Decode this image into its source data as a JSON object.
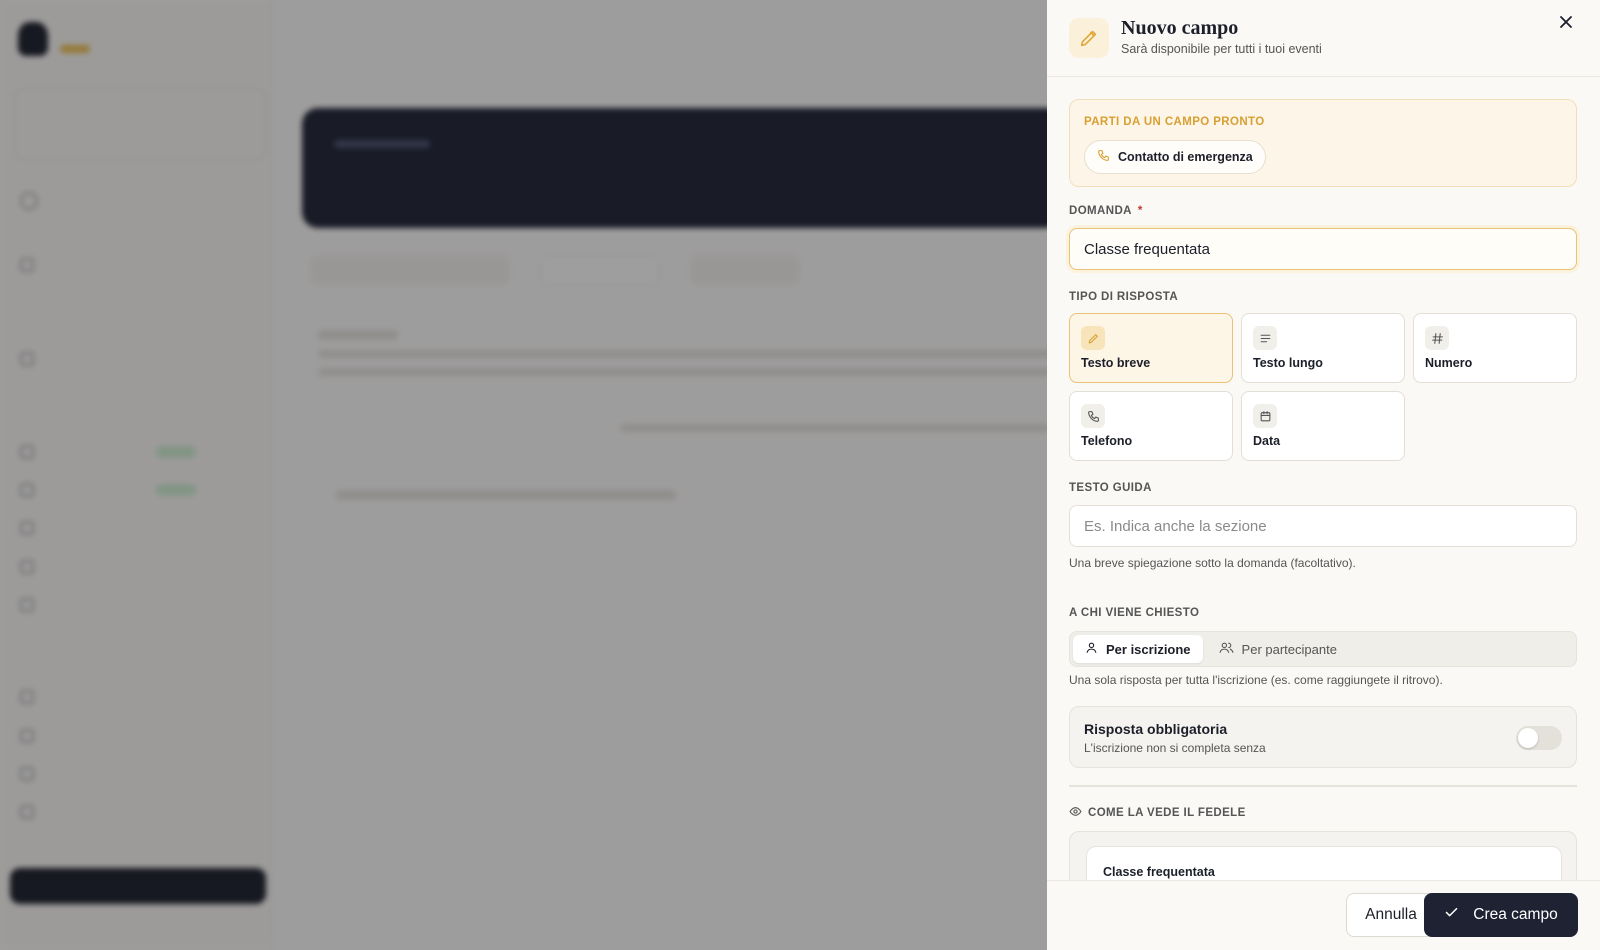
{
  "drawer": {
    "title": "Nuovo campo",
    "subtitle": "Sarà disponibile per tutti i tuoi eventi",
    "preset": {
      "label": "PARTI DA UN CAMPO PRONTO",
      "chip_label": "Contatto di emergenza"
    },
    "question": {
      "label": "DOMANDA",
      "required_mark": "*",
      "value": "Classe frequentata"
    },
    "answer_type": {
      "label": "TIPO DI RISPOSTA",
      "selected": "Testo breve",
      "options": [
        {
          "label": "Testo breve",
          "icon": "pencil-icon"
        },
        {
          "label": "Testo lungo",
          "icon": "lines-icon"
        },
        {
          "label": "Numero",
          "icon": "hash-icon"
        },
        {
          "label": "Telefono",
          "icon": "phone-icon"
        },
        {
          "label": "Data",
          "icon": "calendar-icon"
        }
      ]
    },
    "guide_text": {
      "label": "TESTO GUIDA",
      "placeholder": "Es. Indica anche la sezione",
      "help": "Una breve spiegazione sotto la domanda (facoltativo)."
    },
    "asked_to": {
      "label": "A CHI VIENE CHIESTO",
      "options": [
        "Per iscrizione",
        "Per partecipante"
      ],
      "selected": "Per iscrizione",
      "help": "Una sola risposta per tutta l'iscrizione (es. come raggiungete il ritrovo)."
    },
    "required": {
      "title": "Risposta obbligatoria",
      "subtitle": "L'iscrizione non si completa senza",
      "on": false
    },
    "preview": {
      "label": "COME LA VEDE IL FEDELE",
      "question": "Classe frequentata"
    },
    "footer": {
      "cancel_label": "Annulla",
      "create_label": "Crea campo"
    }
  },
  "colors": {
    "accent": "#e9c277",
    "accent_text": "#d8a033",
    "primary": "#1e2233",
    "required": "#c0392b"
  }
}
